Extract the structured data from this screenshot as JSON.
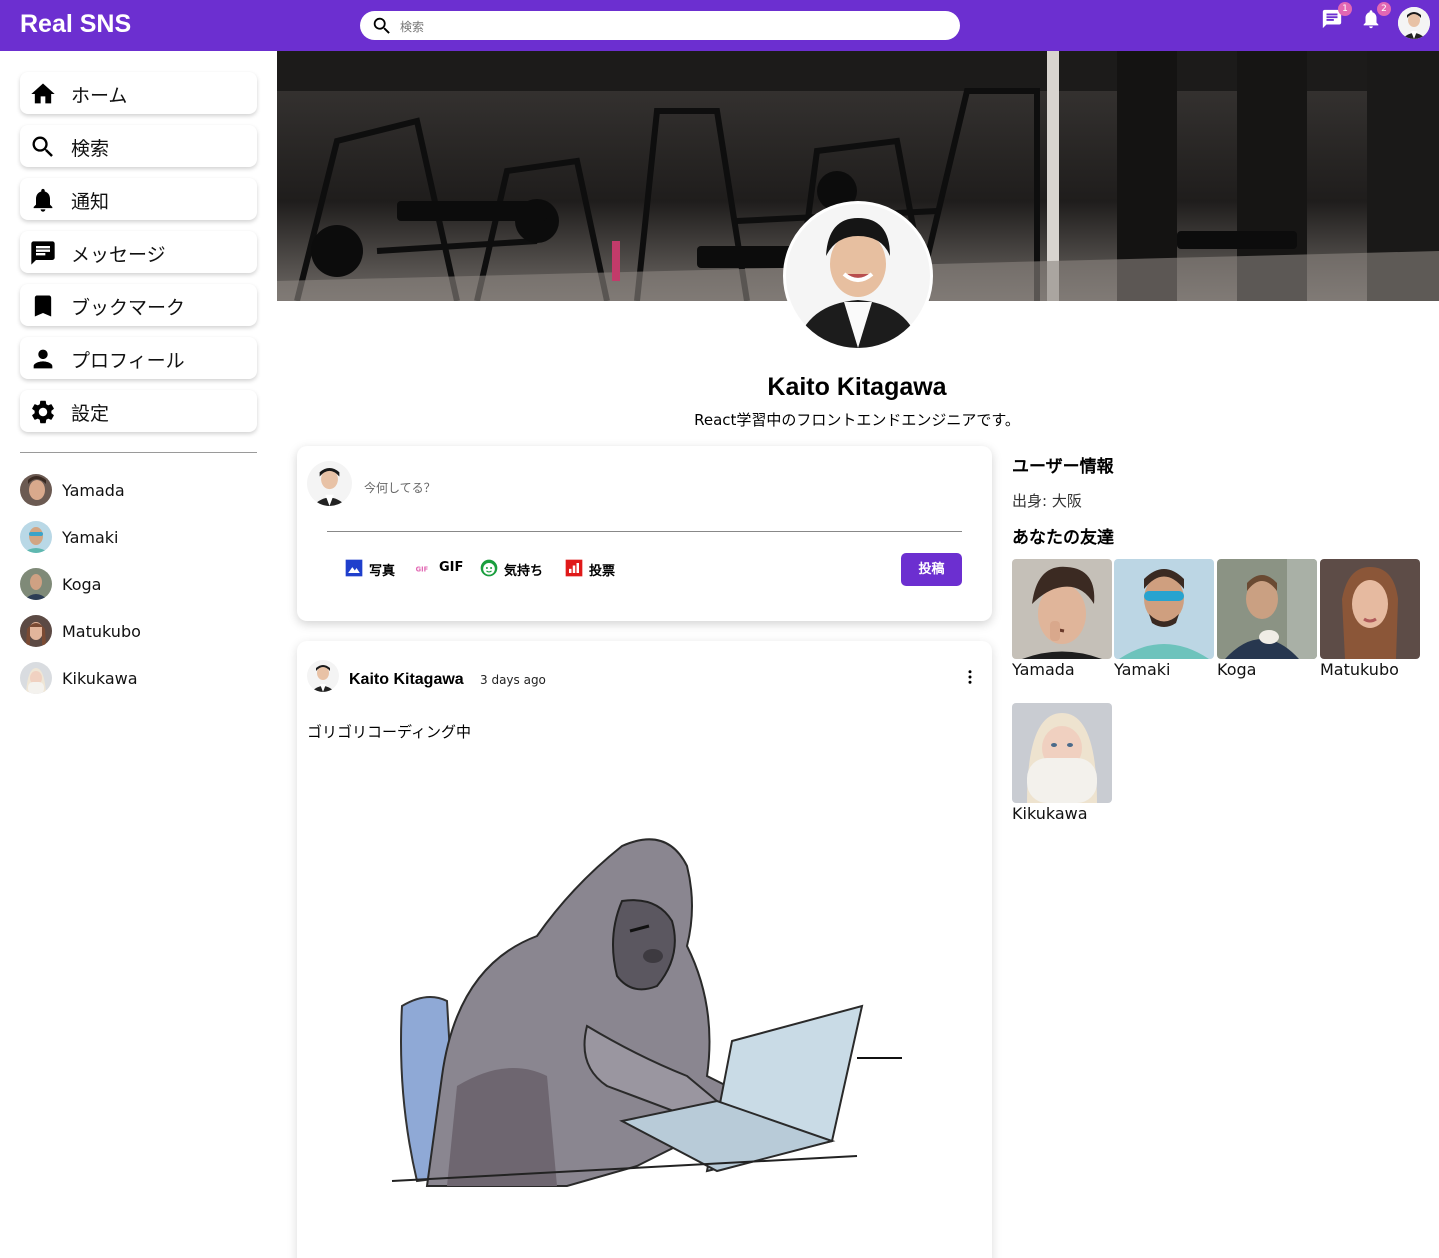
{
  "topbar": {
    "logo": "Real SNS",
    "search_placeholder": "検索",
    "chat_badge": "1",
    "notification_badge": "2"
  },
  "sidebar": {
    "items": [
      {
        "label": "ホーム",
        "icon": "home-icon"
      },
      {
        "label": "検索",
        "icon": "search-icon"
      },
      {
        "label": "通知",
        "icon": "bell-icon"
      },
      {
        "label": "メッセージ",
        "icon": "message-icon"
      },
      {
        "label": "ブックマーク",
        "icon": "bookmark-icon"
      },
      {
        "label": "プロフィール",
        "icon": "person-icon"
      },
      {
        "label": "設定",
        "icon": "gear-icon"
      }
    ],
    "friends": [
      "Yamada",
      "Yamaki",
      "Koga",
      "Matukubo",
      "Kikukawa"
    ]
  },
  "profile": {
    "name": "Kaito Kitagawa",
    "description": "React学習中のフロントエンドエンジニアです。"
  },
  "share": {
    "placeholder": "今何してる？",
    "options": [
      {
        "label": "写真",
        "icon": "image-icon"
      },
      {
        "label": "GIF",
        "icon": "gif-icon"
      },
      {
        "label": "気持ち",
        "icon": "emoji-icon"
      },
      {
        "label": "投票",
        "icon": "poll-icon"
      }
    ],
    "post_button": "投稿"
  },
  "post": {
    "author": "Kaito Kitagawa",
    "date": "3 days ago",
    "text": "ゴリゴリコーディング中"
  },
  "rightbar": {
    "user_info_title": "ユーザー情報",
    "origin": "出身: 大阪",
    "friends_title": "あなたの友達",
    "friends": [
      "Yamada",
      "Yamaki",
      "Koga",
      "Matukubo",
      "Kikukawa"
    ]
  },
  "colors": {
    "brand": "#6c2fd0",
    "badge": "#e267b3"
  }
}
